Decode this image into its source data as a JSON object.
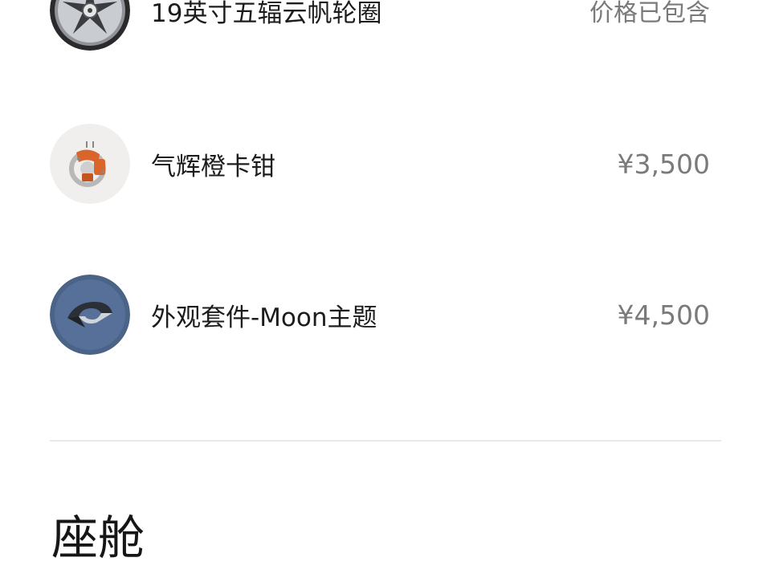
{
  "options": [
    {
      "id": "wheel",
      "label": "19英寸五辐云帆轮圈",
      "price": "价格已包含",
      "icon": "wheel-icon"
    },
    {
      "id": "caliper",
      "label": "气辉橙卡钳",
      "price": "¥3,500",
      "icon": "brake-caliper-icon"
    },
    {
      "id": "moon",
      "label": "外观套件-Moon主题",
      "price": "¥4,500",
      "icon": "moon-theme-badge-icon"
    }
  ],
  "next_section": {
    "title": "座舱"
  },
  "colors": {
    "caliper_orange": "#d9652b",
    "moon_blue": "#4a6387",
    "price_gray": "#7a7a7a",
    "divider": "#e8e8e8"
  }
}
